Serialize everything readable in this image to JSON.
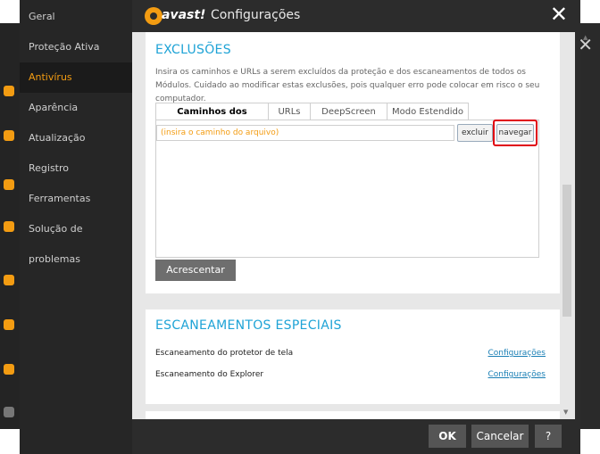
{
  "window": {
    "title": "Configurações",
    "logo_text": "avast!"
  },
  "sidebar": {
    "items": [
      {
        "label": "Geral"
      },
      {
        "label": "Proteção Ativa"
      },
      {
        "label": "Antivírus",
        "active": true
      },
      {
        "label": "Aparência"
      },
      {
        "label": "Atualização"
      },
      {
        "label": "Registro"
      },
      {
        "label": "Ferramentas"
      },
      {
        "label": "Solução de problemas"
      }
    ]
  },
  "exclusions": {
    "title": "EXCLUSÕES",
    "description": "Insira os caminhos e URLs a serem excluídos da proteção e dos escaneamentos de todos os Módulos. Cuidado ao modificar estas exclusões, pois qualquer erro pode colocar em risco o seu computador.",
    "tabs": [
      {
        "label": "Caminhos dos Arquivos",
        "active": true
      },
      {
        "label": "URLs"
      },
      {
        "label": "DeepScreen"
      },
      {
        "label": "Modo Estendido"
      }
    ],
    "path_placeholder": "(insira o caminho do arquivo)",
    "remove_label": "excluir",
    "browse_label": "navegar",
    "add_label": "Acrescentar"
  },
  "special_scans": {
    "title": "ESCANEAMENTOS ESPECIAIS",
    "rows": [
      {
        "label": "Escaneamento do protetor de tela",
        "link": "Configurações"
      },
      {
        "label": "Escaneamento do Explorer",
        "link": "Configurações"
      }
    ]
  },
  "footer": {
    "ok_label": "OK",
    "cancel_label": "Cancelar",
    "help_label": "?"
  },
  "colors": {
    "accent": "#f39c12",
    "heading": "#1ea3d6",
    "highlight": "#e0000f"
  }
}
